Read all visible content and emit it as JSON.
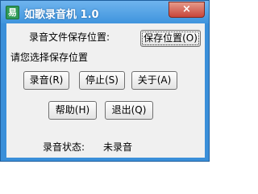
{
  "window": {
    "title": "如歌录音机 1.0",
    "app_icon_glyph": "易",
    "close_glyph": "×"
  },
  "labels": {
    "save_path": "录音文件保存位置:",
    "choose_path": "请您选择保存位置",
    "status_label": "录音状态:",
    "status_value": "未录音"
  },
  "buttons": {
    "save_path": "保存位置(O)",
    "record": "录音(R)",
    "stop": "停止(S)",
    "about": "关于(A)",
    "help": "帮助(H)",
    "exit": "退出(Q)"
  },
  "colors": {
    "titlebar": "#3f94dd",
    "client_bg": "#f0f0f0",
    "close_button": "#c8453a"
  }
}
